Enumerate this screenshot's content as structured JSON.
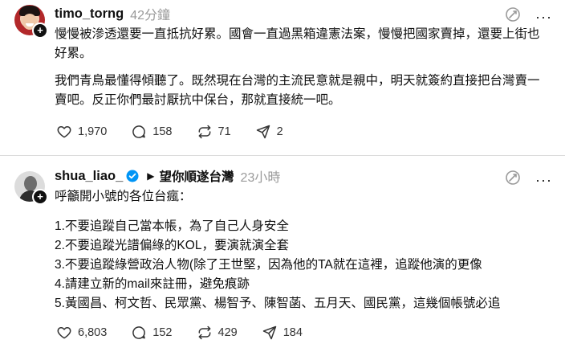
{
  "posts": [
    {
      "username": "timo_torng",
      "time": "42分鐘",
      "paragraphs": [
        "慢慢被滲透還要一直抵抗好累。國會一直過黑箱違憲法案，慢慢把國家賣掉，還要上街也好累。",
        "我們青鳥最懂得傾聽了。既然現在台灣的主流民意就是親中，明天就簽約直接把台灣賣一賣吧。反正你們最討厭抗中保台，那就直接統一吧。"
      ],
      "likes": "1,970",
      "comments": "158",
      "reposts": "71",
      "shares": "2",
      "icons": [
        "heart-icon",
        "comment-icon",
        "repost-icon",
        "send-icon",
        "no-repost-icon",
        "more-icon"
      ]
    },
    {
      "username": "shua_liao_",
      "verified": true,
      "mention_arrow": "▶",
      "mention": "望你順遂台灣",
      "time": "23小時",
      "intro": "呼籲開小號的各位台瘋：",
      "list": [
        "1.不要追蹤自己當本帳，為了自己人身安全",
        "2.不要追蹤光譜偏綠的KOL，要演就演全套",
        "3.不要追蹤綠營政治人物(除了王世堅，因為他的TA就在這裡，追蹤他演的更像",
        "4.請建立新的mail來註冊，避免痕跡",
        "5.黃國昌、柯文哲、民眾黨、楊智予、陳智菡、五月天、國民黨，這幾個帳號必追"
      ],
      "likes": "6,803",
      "comments": "152",
      "reposts": "429",
      "shares": "184"
    }
  ],
  "colors": {
    "text": "#101010",
    "muted": "#9a9a9a",
    "verified": "#0095f6",
    "divider": "#dcdcdc"
  }
}
